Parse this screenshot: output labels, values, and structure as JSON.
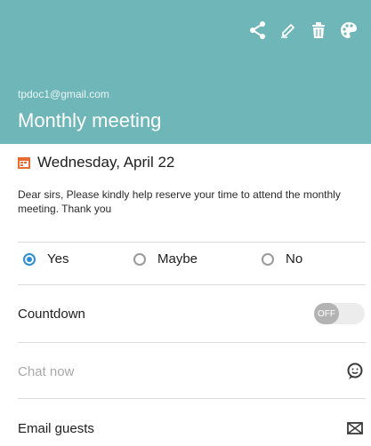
{
  "header": {
    "account": "tpdoc1@gmail.com",
    "title": "Monthly meeting",
    "background": "#6fb6b8",
    "actions": [
      {
        "name": "share",
        "icon": "share-icon"
      },
      {
        "name": "edit",
        "icon": "pencil-icon"
      },
      {
        "name": "delete",
        "icon": "trash-icon"
      },
      {
        "name": "color",
        "icon": "palette-icon"
      }
    ]
  },
  "event": {
    "date": "Wednesday, April 22",
    "date_icon": "calendar-icon",
    "description": "Dear sirs, Please kindly help reserve your time to attend the monthly meeting. Thank you"
  },
  "rsvp": {
    "options": [
      "Yes",
      "Maybe",
      "No"
    ],
    "selected": "Yes",
    "accent": "#2b8fd6"
  },
  "rows": {
    "countdown_label": "Countdown",
    "countdown_toggle": "OFF",
    "chat_label": "Chat now",
    "chat_icon": "chat-smiley-icon",
    "email_label": "Email guests",
    "email_icon": "envelope-icon"
  }
}
